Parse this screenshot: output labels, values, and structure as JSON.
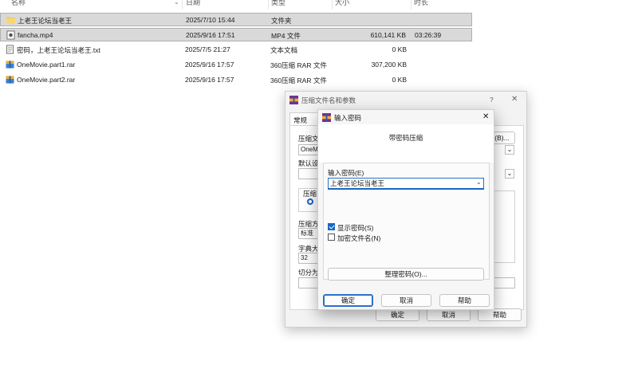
{
  "file_list": {
    "columns": {
      "name": "名称",
      "date": "日期",
      "type": "类型",
      "size": "大小",
      "duration": "时长"
    },
    "rows": [
      {
        "name": "上老王论坛当老王",
        "date": "2025/7/10 15:44",
        "type": "文件夹",
        "size": "",
        "duration": "",
        "icon": "folder-icon"
      },
      {
        "name": "fancha.mp4",
        "date": "2025/9/16 17:51",
        "type": "MP4 文件",
        "size": "610,141 KB",
        "duration": "03:26:39",
        "icon": "video-file-icon"
      },
      {
        "name": "密码，上老王论坛当老王.txt",
        "date": "2025/7/5 21:27",
        "type": "文本文档",
        "size": "0 KB",
        "duration": "",
        "icon": "text-file-icon"
      },
      {
        "name": "OneMovie.part1.rar",
        "date": "2025/9/16 17:57",
        "type": "360压缩 RAR 文件",
        "size": "307,200 KB",
        "duration": "",
        "icon": "rar-archive-icon"
      },
      {
        "name": "OneMovie.part2.rar",
        "date": "2025/9/16 17:57",
        "type": "360压缩 RAR 文件",
        "size": "0 KB",
        "duration": "",
        "icon": "rar-archive-icon"
      }
    ]
  },
  "archive_dialog": {
    "title": "压缩文件名和参数",
    "help_glyph": "?",
    "close_glyph": "✕",
    "tab_general": "常规",
    "archive_label": "压缩文",
    "archive_value": "OneMo",
    "browse_label": "(B)...",
    "default_label": "默认设",
    "format_group": "压缩",
    "method_label": "压缩方",
    "method_value": "标准",
    "dict_label": "字典大",
    "dict_value": "32",
    "split_label": "切分为",
    "ok": "确定",
    "cancel": "取消",
    "help": "帮助"
  },
  "password_dialog": {
    "title": "输入密码",
    "close_glyph": "✕",
    "heading": "带密码压缩",
    "password_label": "输入密码(E)",
    "password_value": "上老王论坛当老王",
    "show_password": "显示密码(S)",
    "show_password_checked": true,
    "encrypt_names": "加密文件名(N)",
    "encrypt_names_checked": false,
    "organize_button": "整理密码(O)...",
    "ok": "确定",
    "cancel": "取消",
    "help": "帮助"
  }
}
